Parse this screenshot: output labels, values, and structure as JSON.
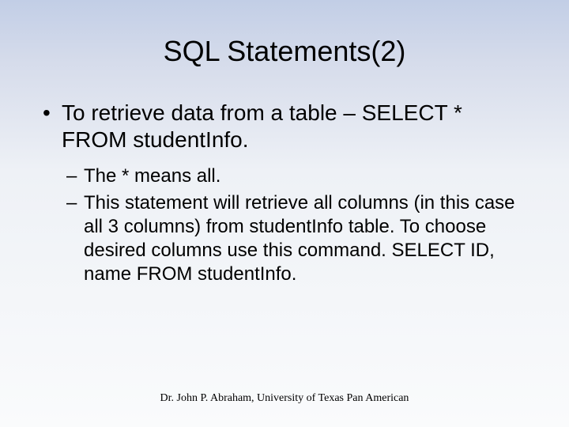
{
  "slide": {
    "title": "SQL Statements(2)",
    "bullets": {
      "main": "To retrieve data from a table – SELECT * FROM studentInfo.",
      "sub1": "The * means all.",
      "sub2": "This statement will retrieve all columns (in this case all 3 columns) from studentInfo table. To choose desired columns use this command. SELECT ID, name FROM studentInfo."
    },
    "footer": "Dr. John P. Abraham, University of Texas Pan American"
  }
}
